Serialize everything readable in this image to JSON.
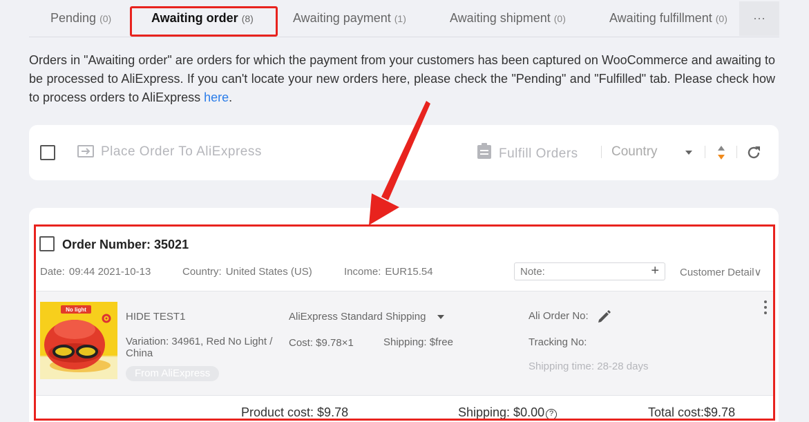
{
  "tabs": [
    {
      "label": "Pending",
      "count": "(0)"
    },
    {
      "label": "Awaiting order",
      "count": "(8)"
    },
    {
      "label": "Awaiting payment",
      "count": "(1)"
    },
    {
      "label": "Awaiting shipment",
      "count": "(0)"
    },
    {
      "label": "Awaiting fulfillment",
      "count": "(0)"
    }
  ],
  "tabs_more": "···",
  "description": {
    "text": "Orders in \"Awaiting order\" are orders for which the payment from your customers has been captured on WooCommerce and awaiting to be processed to AliExpress. If you can't locate your new orders here, please check the \"Pending\" and \"Fulfilled\" tab. Please check how to process orders to AliExpress ",
    "link": "here",
    "end": "."
  },
  "toolbar": {
    "place_order": "Place Order To AliExpress",
    "fulfill_orders": "Fulfill Orders",
    "country": "Country"
  },
  "order": {
    "title": "Order Number: 35021",
    "date_label": "Date:",
    "date": "09:44 2021-10-13",
    "country_label": "Country:",
    "country": "United States (US)",
    "income_label": "Income:",
    "income": "EUR15.54",
    "note_placeholder": "Note:",
    "customer_detail": "Customer Detail∨",
    "item": {
      "image_caption": "No light",
      "name": "HIDE TEST1",
      "variation": "Variation: 34961, Red No Light / China",
      "source_badge": "From AliExpress",
      "shipping_method": "AliExpress Standard Shipping",
      "cost": "Cost: $9.78×1",
      "shipping": "Shipping: $free",
      "ali_order_no": "Ali Order No:",
      "tracking_no": "Tracking No:",
      "shipping_time": "Shipping time: 28-28 days"
    },
    "totals": {
      "product_cost": "Product cost: $9.78",
      "shipping": "Shipping: $0.00",
      "total_cost": "Total cost:$9.78"
    }
  },
  "colors": {
    "highlight": "#e8231e",
    "link": "#2b7de9",
    "accent_sort": "#f08a1c"
  }
}
